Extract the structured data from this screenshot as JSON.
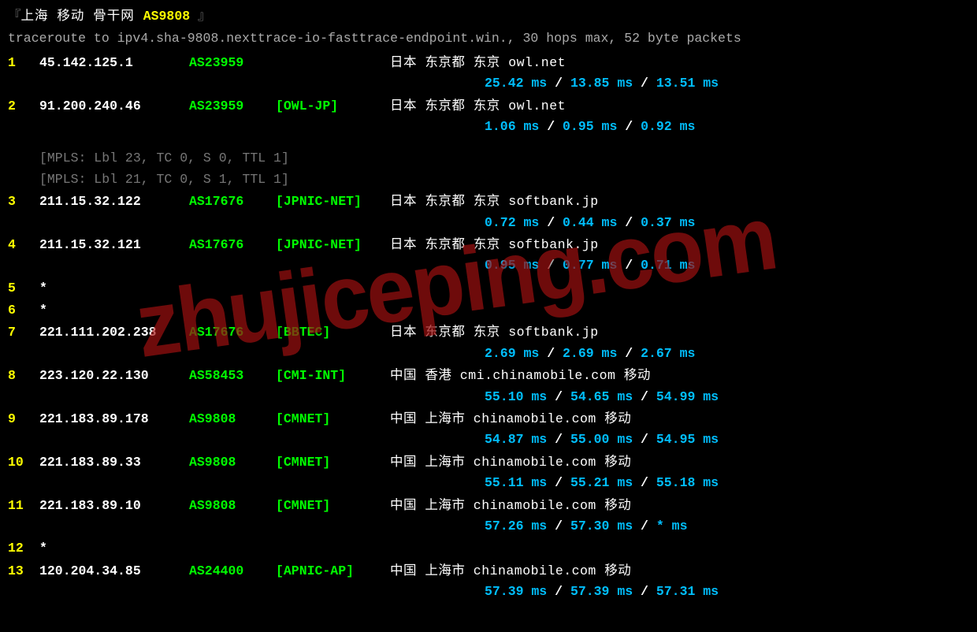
{
  "header": {
    "bracket_open": "『",
    "bracket_close": " 』",
    "title_cn": "上海 移动 骨干网 ",
    "title_asn": "AS9808"
  },
  "subheader": "traceroute to ipv4.sha-9808.nexttrace-io-fasttrace-endpoint.win., 30 hops max, 52 byte packets",
  "watermark": "zhujiceping.com",
  "hops": [
    {
      "num": "1",
      "ip": "45.142.125.1",
      "asn": "AS23959",
      "netname": "",
      "geo": "日本 东京都 东京  owl.net",
      "rtts": [
        "25.42 ms",
        "13.85 ms",
        "13.51 ms"
      ],
      "mpls": []
    },
    {
      "num": "2",
      "ip": "91.200.240.46",
      "asn": "AS23959",
      "netname": "[OWL-JP]",
      "geo": "日本 东京都 东京  owl.net",
      "rtts": [
        "1.06 ms",
        "0.95 ms",
        "0.92 ms"
      ],
      "mpls": [
        "[MPLS: Lbl 23, TC 0, S 0, TTL 1]",
        "[MPLS: Lbl 21, TC 0, S 1, TTL 1]"
      ]
    },
    {
      "num": "3",
      "ip": "211.15.32.122",
      "asn": "AS17676",
      "netname": "[JPNIC-NET]",
      "geo": "日本 东京都 东京  softbank.jp",
      "rtts": [
        "0.72 ms",
        "0.44 ms",
        "0.37 ms"
      ],
      "mpls": []
    },
    {
      "num": "4",
      "ip": "211.15.32.121",
      "asn": "AS17676",
      "netname": "[JPNIC-NET]",
      "geo": "日本 东京都 东京  softbank.jp",
      "rtts": [
        "0.95 ms",
        "0.77 ms",
        "0.71 ms"
      ],
      "mpls": []
    },
    {
      "num": "5",
      "ip": "*",
      "asn": "",
      "netname": "",
      "geo": "",
      "rtts": [],
      "mpls": []
    },
    {
      "num": "6",
      "ip": "*",
      "asn": "",
      "netname": "",
      "geo": "",
      "rtts": [],
      "mpls": []
    },
    {
      "num": "7",
      "ip": "221.111.202.238",
      "asn": "AS17676",
      "netname": "[BBTEC]",
      "geo": "日本 东京都 东京  softbank.jp",
      "rtts": [
        "2.69 ms",
        "2.69 ms",
        "2.67 ms"
      ],
      "mpls": []
    },
    {
      "num": "8",
      "ip": "223.120.22.130",
      "asn": "AS58453",
      "netname": "[CMI-INT]",
      "geo": "中国 香港   cmi.chinamobile.com  移动",
      "rtts": [
        "55.10 ms",
        "54.65 ms",
        "54.99 ms"
      ],
      "mpls": []
    },
    {
      "num": "9",
      "ip": "221.183.89.178",
      "asn": "AS9808",
      "netname": "[CMNET]",
      "geo": "中国 上海市   chinamobile.com  移动",
      "rtts": [
        "54.87 ms",
        "55.00 ms",
        "54.95 ms"
      ],
      "mpls": []
    },
    {
      "num": "10",
      "ip": "221.183.89.33",
      "asn": "AS9808",
      "netname": "[CMNET]",
      "geo": "中国 上海市   chinamobile.com  移动",
      "rtts": [
        "55.11 ms",
        "55.21 ms",
        "55.18 ms"
      ],
      "mpls": []
    },
    {
      "num": "11",
      "ip": "221.183.89.10",
      "asn": "AS9808",
      "netname": "[CMNET]",
      "geo": "中国 上海市   chinamobile.com  移动",
      "rtts": [
        "57.26 ms",
        "57.30 ms",
        "* ms"
      ],
      "mpls": []
    },
    {
      "num": "12",
      "ip": "*",
      "asn": "",
      "netname": "",
      "geo": "",
      "rtts": [],
      "mpls": []
    },
    {
      "num": "13",
      "ip": "120.204.34.85",
      "asn": "AS24400",
      "netname": "[APNIC-AP]",
      "geo": "中国 上海市   chinamobile.com  移动",
      "rtts": [
        "57.39 ms",
        "57.39 ms",
        "57.31 ms"
      ],
      "mpls": []
    }
  ]
}
